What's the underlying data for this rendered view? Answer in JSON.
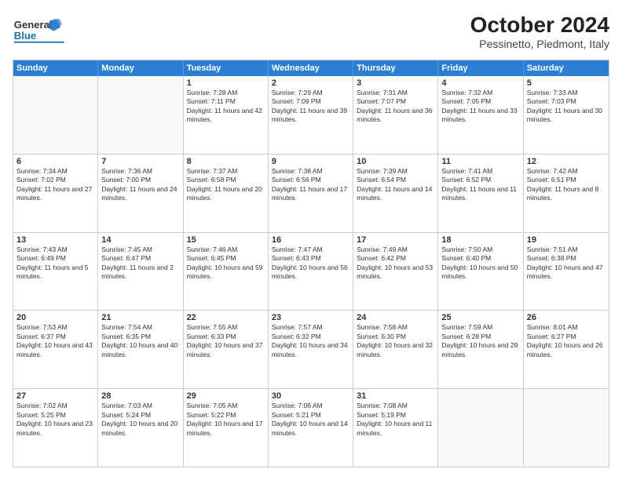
{
  "logo": {
    "line1": "General",
    "line2": "Blue"
  },
  "title": "October 2024",
  "subtitle": "Pessinetto, Piedmont, Italy",
  "days_of_week": [
    "Sunday",
    "Monday",
    "Tuesday",
    "Wednesday",
    "Thursday",
    "Friday",
    "Saturday"
  ],
  "weeks": [
    [
      {
        "day": "",
        "info": ""
      },
      {
        "day": "",
        "info": ""
      },
      {
        "day": "1",
        "info": "Sunrise: 7:28 AM\nSunset: 7:11 PM\nDaylight: 11 hours and 42 minutes."
      },
      {
        "day": "2",
        "info": "Sunrise: 7:29 AM\nSunset: 7:09 PM\nDaylight: 11 hours and 39 minutes."
      },
      {
        "day": "3",
        "info": "Sunrise: 7:31 AM\nSunset: 7:07 PM\nDaylight: 11 hours and 36 minutes."
      },
      {
        "day": "4",
        "info": "Sunrise: 7:32 AM\nSunset: 7:05 PM\nDaylight: 11 hours and 33 minutes."
      },
      {
        "day": "5",
        "info": "Sunrise: 7:33 AM\nSunset: 7:03 PM\nDaylight: 11 hours and 30 minutes."
      }
    ],
    [
      {
        "day": "6",
        "info": "Sunrise: 7:34 AM\nSunset: 7:02 PM\nDaylight: 11 hours and 27 minutes."
      },
      {
        "day": "7",
        "info": "Sunrise: 7:36 AM\nSunset: 7:00 PM\nDaylight: 11 hours and 24 minutes."
      },
      {
        "day": "8",
        "info": "Sunrise: 7:37 AM\nSunset: 6:58 PM\nDaylight: 11 hours and 20 minutes."
      },
      {
        "day": "9",
        "info": "Sunrise: 7:38 AM\nSunset: 6:56 PM\nDaylight: 11 hours and 17 minutes."
      },
      {
        "day": "10",
        "info": "Sunrise: 7:39 AM\nSunset: 6:54 PM\nDaylight: 11 hours and 14 minutes."
      },
      {
        "day": "11",
        "info": "Sunrise: 7:41 AM\nSunset: 6:52 PM\nDaylight: 11 hours and 11 minutes."
      },
      {
        "day": "12",
        "info": "Sunrise: 7:42 AM\nSunset: 6:51 PM\nDaylight: 11 hours and 8 minutes."
      }
    ],
    [
      {
        "day": "13",
        "info": "Sunrise: 7:43 AM\nSunset: 6:49 PM\nDaylight: 11 hours and 5 minutes."
      },
      {
        "day": "14",
        "info": "Sunrise: 7:45 AM\nSunset: 6:47 PM\nDaylight: 11 hours and 2 minutes."
      },
      {
        "day": "15",
        "info": "Sunrise: 7:46 AM\nSunset: 6:45 PM\nDaylight: 10 hours and 59 minutes."
      },
      {
        "day": "16",
        "info": "Sunrise: 7:47 AM\nSunset: 6:43 PM\nDaylight: 10 hours and 56 minutes."
      },
      {
        "day": "17",
        "info": "Sunrise: 7:49 AM\nSunset: 6:42 PM\nDaylight: 10 hours and 53 minutes."
      },
      {
        "day": "18",
        "info": "Sunrise: 7:50 AM\nSunset: 6:40 PM\nDaylight: 10 hours and 50 minutes."
      },
      {
        "day": "19",
        "info": "Sunrise: 7:51 AM\nSunset: 6:38 PM\nDaylight: 10 hours and 47 minutes."
      }
    ],
    [
      {
        "day": "20",
        "info": "Sunrise: 7:53 AM\nSunset: 6:37 PM\nDaylight: 10 hours and 43 minutes."
      },
      {
        "day": "21",
        "info": "Sunrise: 7:54 AM\nSunset: 6:35 PM\nDaylight: 10 hours and 40 minutes."
      },
      {
        "day": "22",
        "info": "Sunrise: 7:55 AM\nSunset: 6:33 PM\nDaylight: 10 hours and 37 minutes."
      },
      {
        "day": "23",
        "info": "Sunrise: 7:57 AM\nSunset: 6:32 PM\nDaylight: 10 hours and 34 minutes."
      },
      {
        "day": "24",
        "info": "Sunrise: 7:58 AM\nSunset: 6:30 PM\nDaylight: 10 hours and 32 minutes."
      },
      {
        "day": "25",
        "info": "Sunrise: 7:59 AM\nSunset: 6:28 PM\nDaylight: 10 hours and 29 minutes."
      },
      {
        "day": "26",
        "info": "Sunrise: 8:01 AM\nSunset: 6:27 PM\nDaylight: 10 hours and 26 minutes."
      }
    ],
    [
      {
        "day": "27",
        "info": "Sunrise: 7:02 AM\nSunset: 5:25 PM\nDaylight: 10 hours and 23 minutes."
      },
      {
        "day": "28",
        "info": "Sunrise: 7:03 AM\nSunset: 5:24 PM\nDaylight: 10 hours and 20 minutes."
      },
      {
        "day": "29",
        "info": "Sunrise: 7:05 AM\nSunset: 5:22 PM\nDaylight: 10 hours and 17 minutes."
      },
      {
        "day": "30",
        "info": "Sunrise: 7:06 AM\nSunset: 5:21 PM\nDaylight: 10 hours and 14 minutes."
      },
      {
        "day": "31",
        "info": "Sunrise: 7:08 AM\nSunset: 5:19 PM\nDaylight: 10 hours and 11 minutes."
      },
      {
        "day": "",
        "info": ""
      },
      {
        "day": "",
        "info": ""
      }
    ]
  ]
}
